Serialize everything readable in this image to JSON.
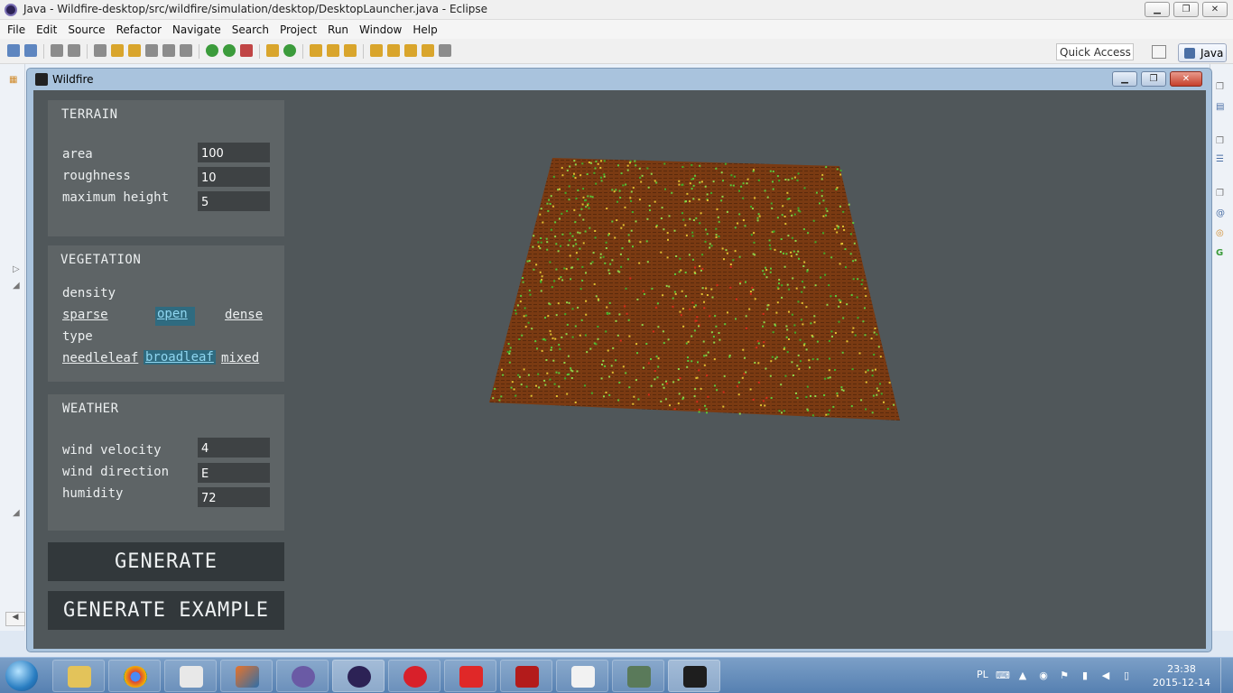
{
  "window": {
    "title": "Java - Wildfire-desktop/src/wildfire/simulation/desktop/DesktopLauncher.java - Eclipse",
    "minimize": "▁",
    "maximize": "❐",
    "close": "✕"
  },
  "menu": [
    "File",
    "Edit",
    "Source",
    "Refactor",
    "Navigate",
    "Search",
    "Project",
    "Run",
    "Window",
    "Help"
  ],
  "toolbar": {
    "quick_access": "Quick Access",
    "perspective": "Java"
  },
  "app": {
    "title": "Wildfire",
    "minimize": "▁",
    "maximize": "❐",
    "close": "✕",
    "terrain": {
      "title": "TERRAIN",
      "area_label": "area",
      "area_value": "100",
      "roughness_label": "roughness",
      "roughness_value": "10",
      "max_height_label": "maximum height",
      "max_height_value": "5"
    },
    "vegetation": {
      "title": "VEGETATION",
      "density_label": "density",
      "density_options": [
        "sparse",
        "open",
        "dense"
      ],
      "density_selected": "open",
      "type_label": "type",
      "type_options": [
        "needleleaf",
        "broadleaf",
        "mixed"
      ],
      "type_selected": "broadleaf"
    },
    "weather": {
      "title": "WEATHER",
      "wind_velocity_label": "wind velocity",
      "wind_velocity_value": "4",
      "wind_direction_label": "wind direction",
      "wind_direction_value": "E",
      "humidity_label": "humidity",
      "humidity_value": "72"
    },
    "generate_label": "GENERATE",
    "generate_example_label": "GENERATE EXAMPLE"
  },
  "taskbar": {
    "language": "PL",
    "time": "23:38",
    "date": "2015-12-14"
  },
  "colors": {
    "canvas": "#50575a",
    "panel": "#5e6466",
    "terrain": "#7a3a12",
    "selected_option": "#2f6b80"
  }
}
